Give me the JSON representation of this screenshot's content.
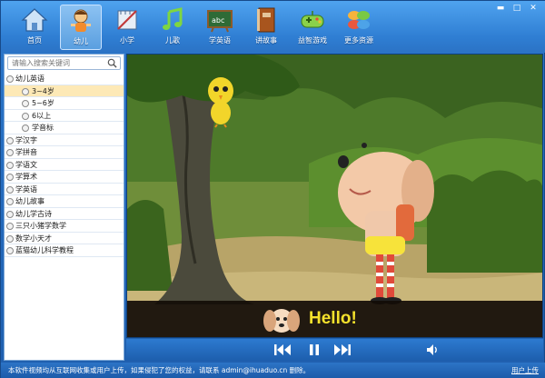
{
  "toolbar": {
    "items": [
      {
        "label": "首页",
        "icon": "home-icon"
      },
      {
        "label": "幼儿",
        "icon": "child-icon"
      },
      {
        "label": "小学",
        "icon": "ruler-icon"
      },
      {
        "label": "儿歌",
        "icon": "music-note-icon"
      },
      {
        "label": "学英语",
        "icon": "chalkboard-icon"
      },
      {
        "label": "讲故事",
        "icon": "book-icon"
      },
      {
        "label": "益智游戏",
        "icon": "gamepad-icon"
      },
      {
        "label": "更多资源",
        "icon": "pinwheel-icon"
      }
    ],
    "active_index": 1
  },
  "search": {
    "placeholder": "请输入搜索关键词"
  },
  "tree": [
    {
      "label": "幼儿英语",
      "level": 0
    },
    {
      "label": "3~4岁",
      "level": 1,
      "selected": true
    },
    {
      "label": "5~6岁",
      "level": 1
    },
    {
      "label": "6以上",
      "level": 1
    },
    {
      "label": "学音标",
      "level": 1
    },
    {
      "label": "学汉字",
      "level": 0
    },
    {
      "label": "学拼音",
      "level": 0
    },
    {
      "label": "学语文",
      "level": 0
    },
    {
      "label": "学算术",
      "level": 0
    },
    {
      "label": "学英语",
      "level": 0
    },
    {
      "label": "幼儿故事",
      "level": 0
    },
    {
      "label": "幼儿学古诗",
      "level": 0
    },
    {
      "label": "三只小猪学数学",
      "level": 0
    },
    {
      "label": "数学小天才",
      "level": 0
    },
    {
      "label": "蓝猫幼儿科学教程",
      "level": 0
    }
  ],
  "video": {
    "subtitle": "Hello!"
  },
  "status": {
    "message": "本软件视频均从互联网收集或用户上传，如果侵犯了您的权益，请联系 admin@ihuaduo.cn 删除。",
    "upload_link": "用户上传"
  },
  "colors": {
    "accent": "#2f7ed3",
    "selection": "#fde9b6",
    "subtitle": "#f5e22c"
  }
}
